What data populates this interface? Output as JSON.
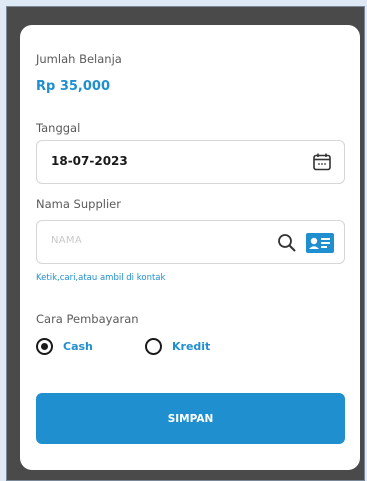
{
  "form": {
    "total_label": "Jumlah Belanja",
    "total_value": "Rp 35,000",
    "date_label": "Tanggal",
    "date_value": "18-07-2023",
    "supplier_label": "Nama Supplier",
    "supplier_placeholder": "NAMA",
    "supplier_hint": "Ketik,cari,atau ambil di kontak",
    "payment_label": "Cara Pembayaran",
    "payment_options": [
      {
        "label": "Cash",
        "selected": true
      },
      {
        "label": "Kredit",
        "selected": false
      }
    ],
    "save_label": "SIMPAN"
  },
  "colors": {
    "accent": "#1f8fcf",
    "overlay": "#4a4a4a",
    "background": "#dfe9f5"
  },
  "icons": {
    "date": "calendar-icon",
    "search": "search-icon",
    "contact": "contact-card-icon"
  }
}
